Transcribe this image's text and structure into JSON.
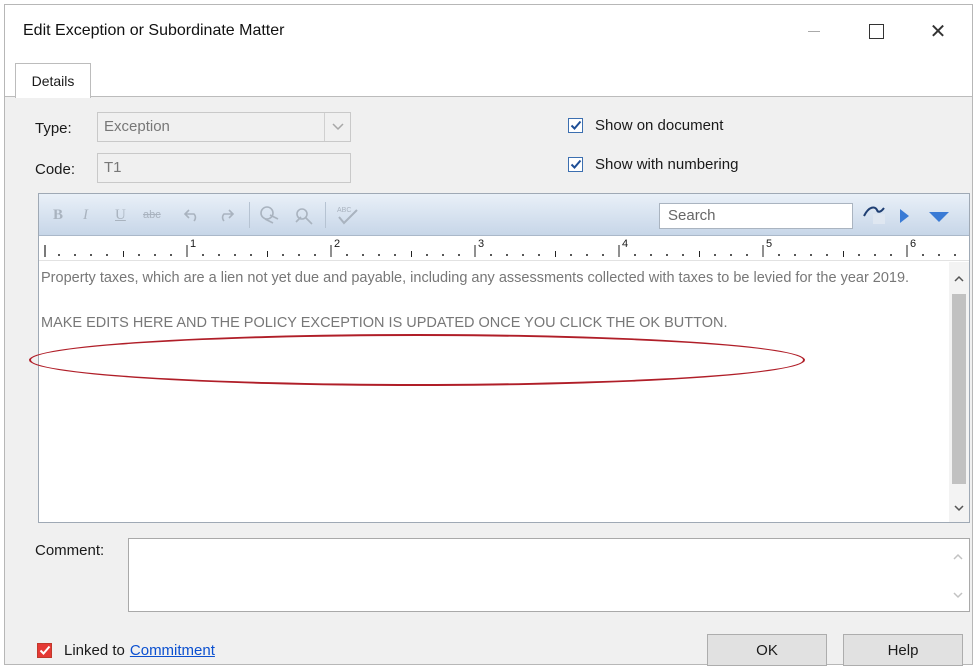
{
  "window": {
    "title": "Edit Exception or Subordinate Matter",
    "close_glyph": "✕"
  },
  "tabs": [
    {
      "label": "Details"
    }
  ],
  "form": {
    "type_label": "Type:",
    "type_value": "Exception",
    "code_label": "Code:",
    "code_value": "T1",
    "show_on_document_label": "Show on document",
    "show_on_document_checked": true,
    "show_with_numbering_label": "Show with numbering",
    "show_with_numbering_checked": true
  },
  "toolbar": {
    "bold": "B",
    "italic": "I",
    "underline": "U",
    "strike": "abc",
    "search_placeholder": "Search"
  },
  "ruler": {
    "marks": [
      "1",
      "2",
      "3",
      "4",
      "5",
      "6"
    ]
  },
  "editor": {
    "paragraph_1": "Property taxes, which are a lien not yet due and payable, including any assessments collected with taxes to be levied for the year 2019.",
    "paragraph_2": "MAKE EDITS HERE AND THE POLICY EXCEPTION IS UPDATED ONCE YOU CLICK THE OK BUTTON."
  },
  "comment": {
    "label": "Comment:",
    "value": ""
  },
  "footer": {
    "linked_label": "Linked to",
    "linked_link": "Commitment",
    "linked_checked": true,
    "ok_label": "OK",
    "help_label": "Help"
  },
  "colors": {
    "annotation": "#b01e28",
    "link": "#0b50d0",
    "check_accent": "#3c6fb0"
  }
}
